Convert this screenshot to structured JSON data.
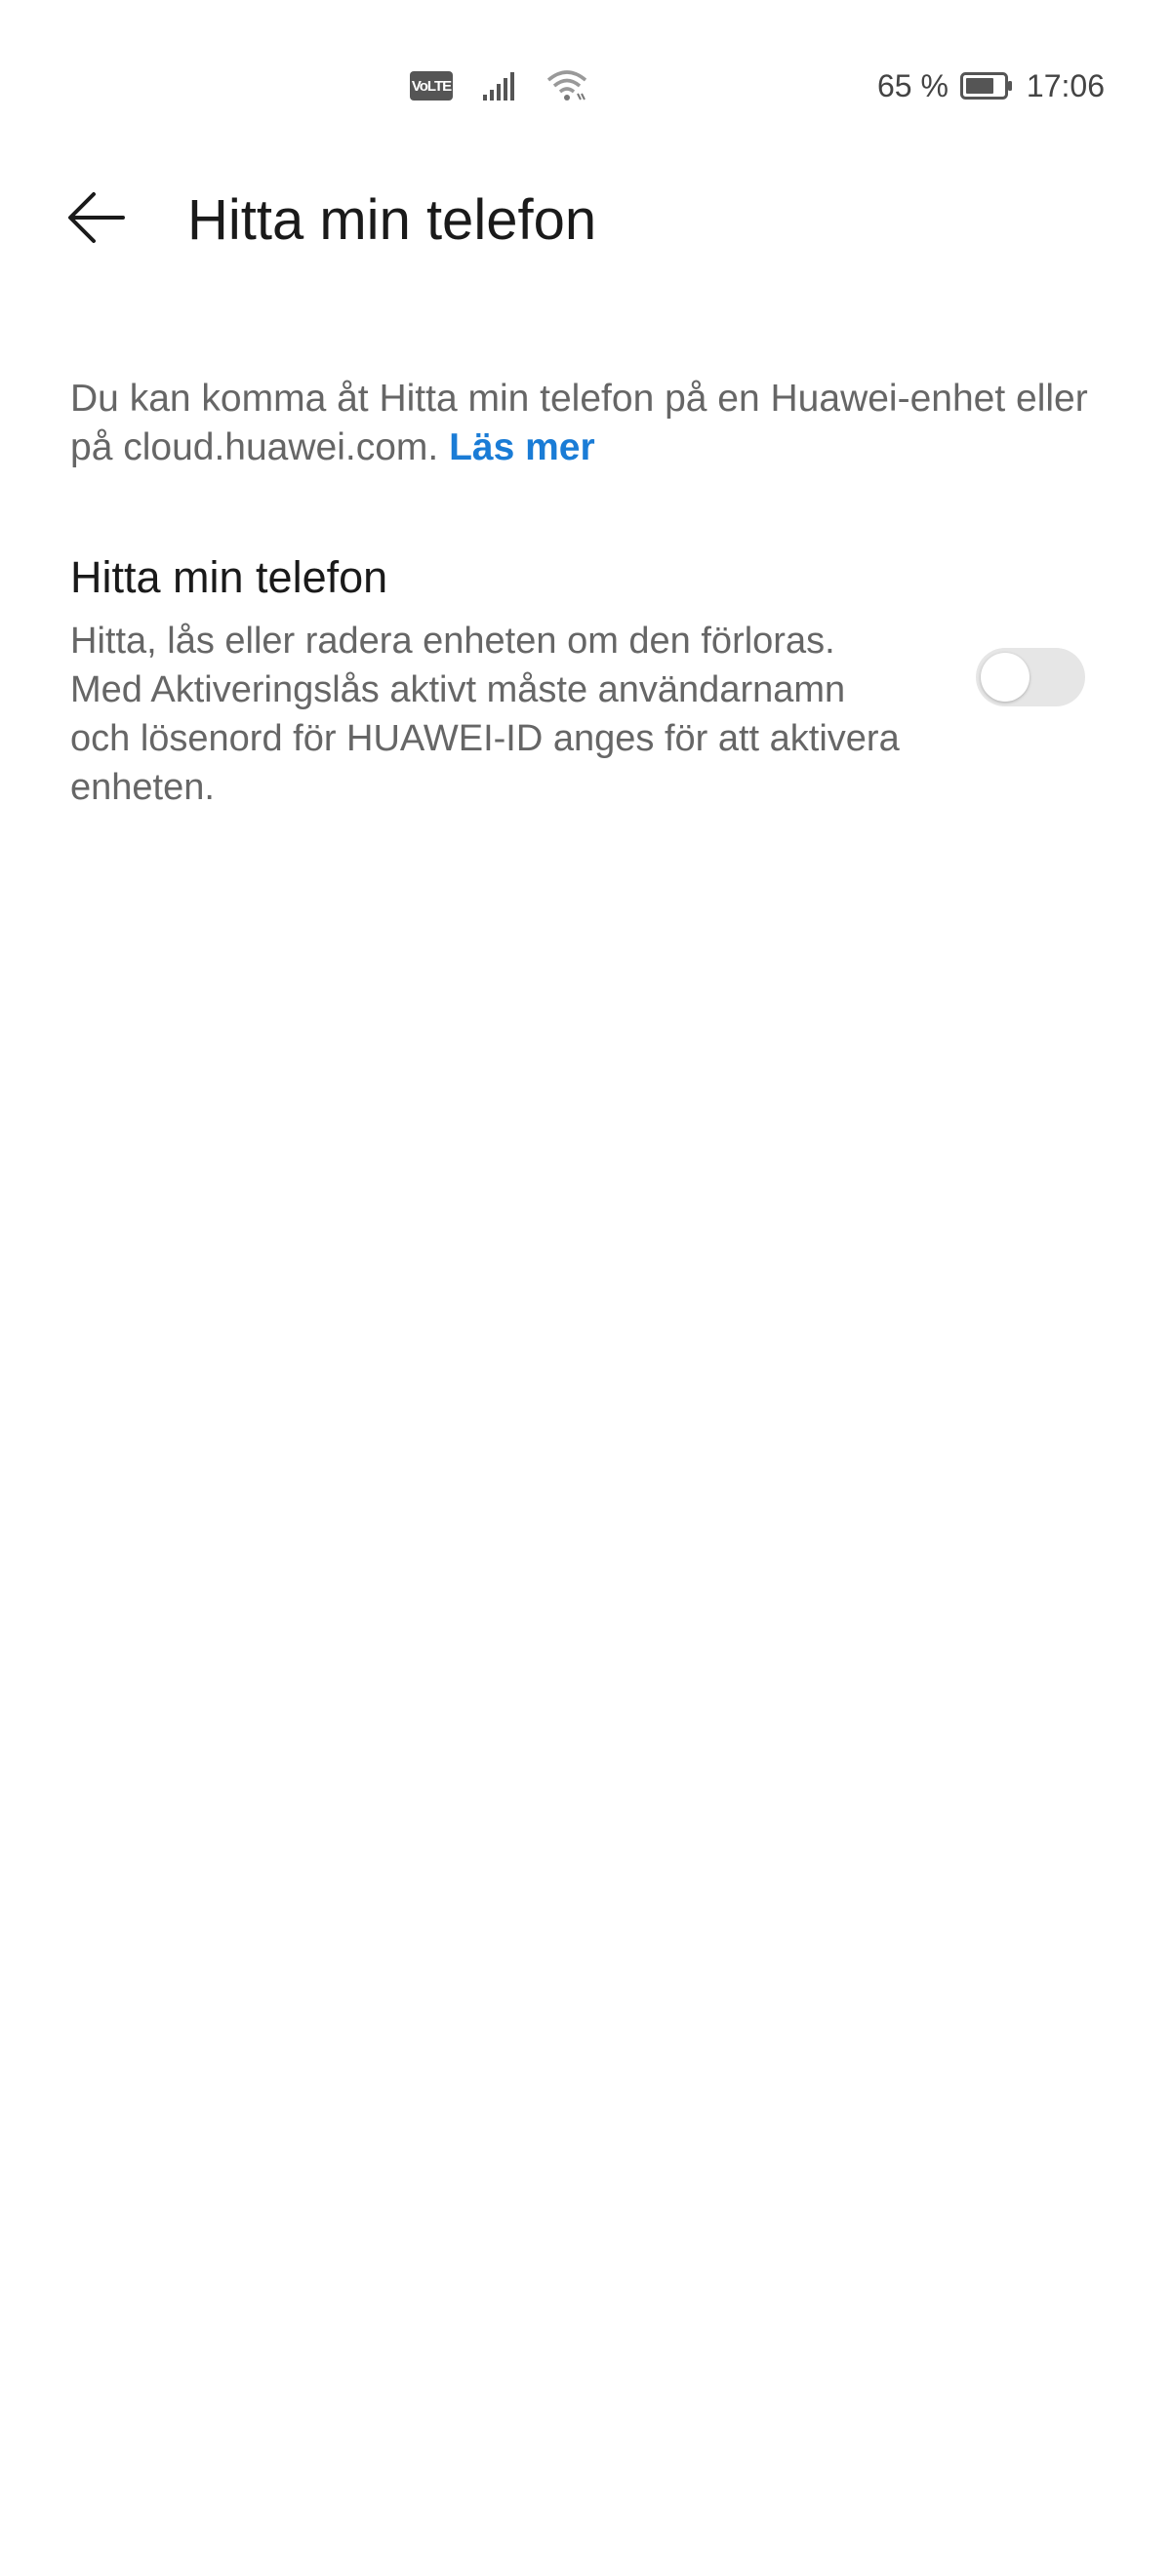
{
  "status_bar": {
    "volte_label": "VoLTE",
    "battery_percent": "65 %",
    "battery_level": 0.65,
    "time": "17:06",
    "icons": [
      "volte-icon",
      "signal-icon",
      "wifi-icon",
      "battery-icon"
    ]
  },
  "app_bar": {
    "back_icon": "arrow-left-icon",
    "title": "Hitta min telefon"
  },
  "description": {
    "text": "Du kan komma åt Hitta min telefon på en Huawei-enhet eller på cloud.huawei.com. ",
    "link_label": "Läs mer",
    "link_color": "#1a7cd6"
  },
  "setting": {
    "title": "Hitta min telefon",
    "description": "Hitta, lås eller radera enheten om den förloras. Med Aktiveringslås aktivt måste användarnamn och lösenord för HUAWEI-ID anges för att aktivera enheten.",
    "toggle_on": false
  }
}
